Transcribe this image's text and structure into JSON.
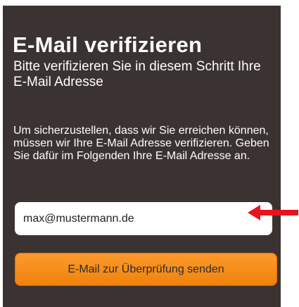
{
  "header": {
    "title": "E-Mail verifizieren",
    "subtitle": "Bitte verifizieren Sie in diesem Schritt Ihre E-Mail Adresse"
  },
  "body": {
    "description": "Um sicherzustellen, dass wir Sie erreichen können, müssen wir Ihre E-Mail Adresse verifizieren. Geben Sie dafür im Folgenden Ihre E-Mail Adresse an."
  },
  "form": {
    "email_value": "max@mustermann.de",
    "submit_label": "E-Mail zur Überprüfung senden"
  },
  "annotation": {
    "arrow_icon": "left-arrow-icon",
    "arrow_color": "#e8141c"
  },
  "colors": {
    "panel_background": "#3b3331",
    "button_orange": "#f48b17"
  }
}
